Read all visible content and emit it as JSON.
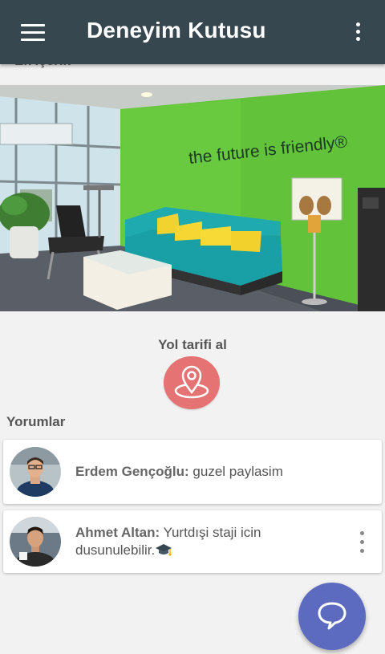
{
  "app_bar": {
    "title": "Deneyim Kutusu",
    "menu_icon": "hamburger-menu-icon",
    "more_icon": "more-vertical-icon",
    "color": "#37474f"
  },
  "content": {
    "section_label": "Ek İçerik",
    "photo_wall_text": "the future is friendly®"
  },
  "directions": {
    "label": "Yol tarifi al",
    "icon": "map-pin-icon",
    "button_color": "#e57373"
  },
  "comments": {
    "heading": "Yorumlar",
    "items": [
      {
        "author": "Erdem Gençoğlu:",
        "text": "guzel paylasim"
      },
      {
        "author": "Ahmet Altan:",
        "text": "Yurtdışi staji icin dusunulebilir.",
        "emoji": "graduation-cap-icon"
      }
    ]
  },
  "fab": {
    "icon": "chat-bubble-icon",
    "color": "#5c6bc0"
  }
}
